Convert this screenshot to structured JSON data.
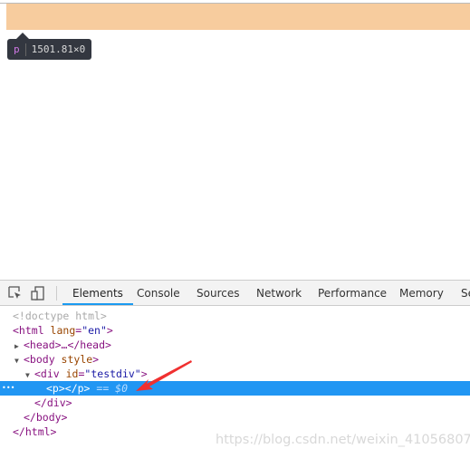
{
  "overlay": {
    "tag": "p",
    "size": "1501.81×0",
    "highlight_color": "#f7cc9e"
  },
  "toolbar": {
    "icons": [
      "inspect-element-icon",
      "device-toolbar-icon"
    ],
    "tabs": [
      {
        "label": "Elements",
        "active": true
      },
      {
        "label": "Console"
      },
      {
        "label": "Sources"
      },
      {
        "label": "Network"
      },
      {
        "label": "Performance"
      },
      {
        "label": "Memory"
      },
      {
        "label": "Se"
      }
    ]
  },
  "tree": {
    "doctype": "<!doctype html>",
    "html_open": "<html ",
    "lang_attr": "lang",
    "lang_val": "\"en\"",
    "head": "<head>…</head>",
    "body_open": "<body ",
    "body_attr": "style",
    "div_open": "<div ",
    "div_attr": "id",
    "div_val": "\"testdiv\"",
    "p": "<p></p>",
    "p_suffix": " == $0",
    "div_close": "</div>",
    "body_close": "</body>",
    "html_close": "</html>",
    "ellipsis": "•••"
  },
  "selected_color": "#2196f3",
  "watermark": "https://blog.csdn.net/weixin_41056807"
}
